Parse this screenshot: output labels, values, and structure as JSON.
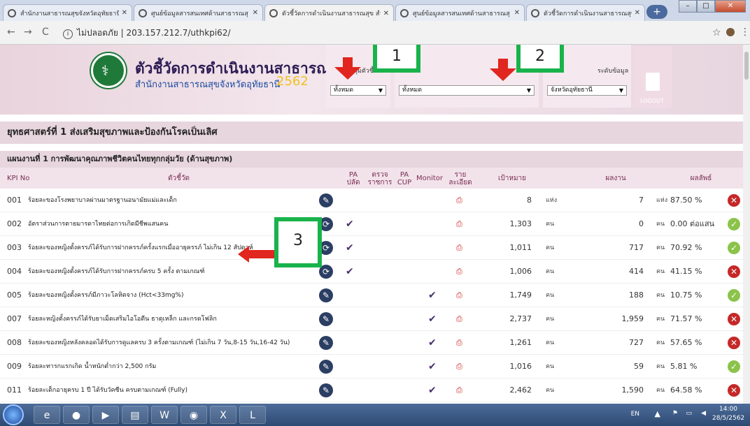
{
  "browser": {
    "tabs": [
      {
        "title": "สำนักงานสาธารณสุขจังหวัดอุทัยธานี",
        "active": false
      },
      {
        "title": "ศูนย์ข้อมูลสารสนเทศด้านสาธารณสุ",
        "active": false
      },
      {
        "title": "ตัวชี้วัดการดำเนินงานสาธารณสุข สำ",
        "active": true
      },
      {
        "title": "ศูนย์ข้อมูลสารสนเทศด้านสาธารณสุ",
        "active": false
      },
      {
        "title": "ตัวชี้วัดการดำเนินงานสาธารณสุข สำ",
        "active": false
      }
    ],
    "url_security": "ไม่ปลอดภัย",
    "url": "203.157.212.7/uthkpi62/"
  },
  "header": {
    "title": "ตัวชี้วัดการดำเนินงานสาธารณสุข",
    "subtitle": "สำนักงานสาธารณสุขจังหวัดอุทัยธานี",
    "year": "2562",
    "filter_group_label": "กลุ่มตัวชี้วัด",
    "filter_group_value": "ทั้งหมด",
    "filter_strategy_value": "ทั้งหมด",
    "filter_area_label": "ระดับข้อมูล",
    "filter_area_value": "จังหวัดอุทัยธานี",
    "logout_label": "LOGOUT"
  },
  "strategy": "ยุทธศาสตร์ที่ 1 ส่งเสริมสุขภาพและป้องกันโรคเป็นเลิศ",
  "plan": "แผนงานที่ 1 การพัฒนาคุณภาพชีวิตคนไทยทุกกลุ่มวัย (ด้านสุขภาพ)",
  "columns": {
    "kpi_no": "KPI No",
    "indicator": "ตัวชี้วัด",
    "pa_ptt": "PA\nปลัด",
    "inspect": "ตรวจ\nราชการ",
    "pa_cup": "PA\nCUP",
    "monitor": "Monitor",
    "detail": "ราย\nละเอียด",
    "target": "เป้าหมาย",
    "result": "ผลงาน",
    "outcome": "ผลลัพธ์"
  },
  "rows": [
    {
      "no": "001",
      "name": "ร้อยละของโรงพยาบาลผ่านมาตรฐานอนามัยแม่และเด็ก",
      "pa": false,
      "monitor": false,
      "target": "8",
      "target_unit": "แห่ง",
      "result": "7",
      "result_unit": "แห่ง",
      "outcome": "87.50 %",
      "status": "fail"
    },
    {
      "no": "002",
      "name": "อัตราส่วนการตายมารดาไทยต่อการเกิดมีชีพแสนคน",
      "pa": true,
      "monitor": false,
      "target": "1,303",
      "target_unit": "คน",
      "result": "0",
      "result_unit": "คน",
      "outcome": "0.00  ต่อแสน",
      "status": "pass"
    },
    {
      "no": "003",
      "name": "ร้อยละของหญิงตั้งครรภ์ได้รับการฝากครรภ์ครั้งแรกเมื่ออายุครรภ์ ไม่เกิน 12 สัปดาห์",
      "pa": true,
      "monitor": false,
      "target": "1,011",
      "target_unit": "คน",
      "result": "717",
      "result_unit": "คน",
      "outcome": "70.92 %",
      "status": "pass"
    },
    {
      "no": "004",
      "name": "ร้อยละของหญิงตั้งครรภ์ได้รับการฝากครรภ์ครบ 5 ครั้ง ตามเกณฑ์",
      "pa": true,
      "monitor": false,
      "target": "1,006",
      "target_unit": "คน",
      "result": "414",
      "result_unit": "คน",
      "outcome": "41.15 %",
      "status": "fail"
    },
    {
      "no": "005",
      "name": "ร้อยละของหญิงตั้งครรภ์มีภาวะโลหิตจาง (Hct<33mg%)",
      "pa": false,
      "monitor": true,
      "target": "1,749",
      "target_unit": "คน",
      "result": "188",
      "result_unit": "คน",
      "outcome": "10.75 %",
      "status": "pass"
    },
    {
      "no": "007",
      "name": "ร้อยละหญิงตั้งครรภ์ได้รับยาเม็ดเสริมไอโอดีน ธาตุเหล็ก และกรดโฟลิก",
      "pa": false,
      "monitor": true,
      "target": "2,737",
      "target_unit": "คน",
      "result": "1,959",
      "result_unit": "คน",
      "outcome": "71.57 %",
      "status": "fail"
    },
    {
      "no": "008",
      "name": "ร้อยละของหญิงหลังคลอดได้รับการดูแลครบ 3 ครั้งตามเกณฑ์ (ไม่เกิน 7 วัน,8-15 วัน,16-42 วัน)",
      "pa": false,
      "monitor": true,
      "target": "1,261",
      "target_unit": "คน",
      "result": "727",
      "result_unit": "คน",
      "outcome": "57.65 %",
      "status": "fail"
    },
    {
      "no": "009",
      "name": "ร้อยละทารกแรกเกิด น้ำหนักต่ำกว่า 2,500 กรัม",
      "pa": false,
      "monitor": true,
      "target": "1,016",
      "target_unit": "คน",
      "result": "59",
      "result_unit": "คน",
      "outcome": "5.81 %",
      "status": "pass"
    },
    {
      "no": "011",
      "name": "ร้อยละเด็กอายุครบ 1 ปี ได้รับวัคซีน ครบตามเกณฑ์ (Fully)",
      "pa": false,
      "monitor": true,
      "target": "2,462",
      "target_unit": "คน",
      "result": "1,590",
      "result_unit": "คน",
      "outcome": "64.58 %",
      "status": "fail"
    }
  ],
  "annotations": [
    "1",
    "2",
    "3"
  ],
  "taskbar": {
    "lang": "EN",
    "time": "14:00",
    "date": "28/5/2562"
  },
  "colors": {
    "fail": "#c62828",
    "pass": "#8bc34a",
    "annotation_border": "#19b34b",
    "arrow": "#e0261e"
  }
}
